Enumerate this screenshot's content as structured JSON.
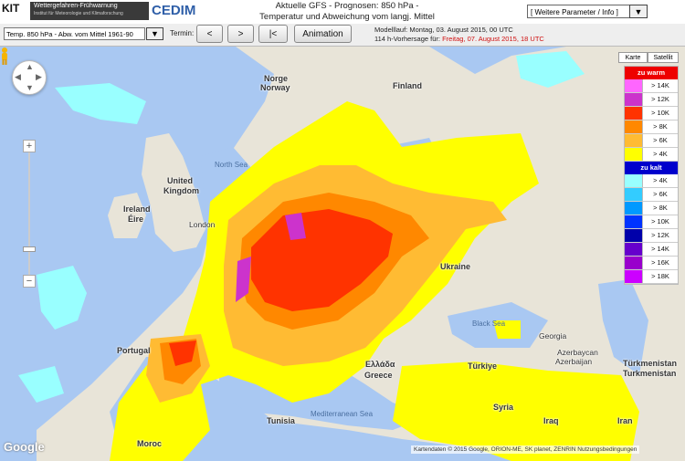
{
  "header": {
    "logo_kit": "KIT",
    "logo_wf_title": "Wettergefahren-Frühwarnung",
    "logo_wf_sub": "Institut für Meteorologie und Klimaforschung",
    "logo_cedim": "CEDIM",
    "title_line1": "Aktuelle GFS - Prognosen: 850 hPa -",
    "title_line2": "Temperatur und Abweichung vom langj. Mittel",
    "param_select": "[ Weitere Parameter / Info ]"
  },
  "toolbar": {
    "variable_select": "Temp. 850 hPa - Abw. vom Mittel 1961-90",
    "termin_label": "Termin:",
    "prev_label": "<",
    "next_label": ">",
    "first_label": "|<",
    "animation_label": "Animation",
    "modell_line": "Modelllauf: Montag, 03. August 2015, 00 UTC",
    "vorhersage_prefix": "114 h-Vorhersage für:",
    "vorhersage_value": "Freitag, 07. August 2015, 18 UTC"
  },
  "map": {
    "maptype_karte": "Karte",
    "maptype_satellit": "Satellit",
    "zoom_in": "+",
    "zoom_out": "−",
    "google": "Google",
    "footer": "Kartendaten © 2015 Google, ORION-ME, SK planet, ZENRIN   Nutzungsbedingungen",
    "labels": {
      "norway": "Norge",
      "norway2": "Norway",
      "finland": "Finland",
      "north_sea": "North Sea",
      "uk1": "United",
      "uk2": "Kingdom",
      "ireland1": "Ireland",
      "ireland2": "Éire",
      "london": "London",
      "portugal": "Portugal",
      "ukraine": "Ukraine",
      "black_sea": "Black Sea",
      "georgia": "Georgia",
      "azerbaijan": "Azerbaycan",
      "azerbaijan2": "Azerbaijan",
      "turkmen1": "Türkmenistan",
      "turkmen2": "Turkmenistan",
      "greece1": "Ελλάδα",
      "greece2": "Greece",
      "turkey": "Türkiye",
      "syria": "Syria",
      "iraq": "Iraq",
      "iran": "Iran",
      "tunisia": "Tunisia",
      "morocco": "Moroc",
      "med_sea": "Mediterranean Sea"
    }
  },
  "legend": {
    "warm_header": "zu warm",
    "cold_header": "zu kalt",
    "warm": [
      {
        "label": "> 14K",
        "color": "#ff66ff"
      },
      {
        "label": "> 12K",
        "color": "#cc33cc"
      },
      {
        "label": "> 10K",
        "color": "#ff3300"
      },
      {
        "label": "> 8K",
        "color": "#ff8800"
      },
      {
        "label": "> 6K",
        "color": "#ffbb33"
      },
      {
        "label": "> 4K",
        "color": "#ffff00"
      }
    ],
    "cold": [
      {
        "label": "> 4K",
        "color": "#99ffff"
      },
      {
        "label": "> 6K",
        "color": "#33ccff"
      },
      {
        "label": "> 8K",
        "color": "#0099ff"
      },
      {
        "label": "> 10K",
        "color": "#0033ff"
      },
      {
        "label": "> 12K",
        "color": "#0000aa"
      },
      {
        "label": "> 14K",
        "color": "#6600cc"
      },
      {
        "label": "> 16K",
        "color": "#9900cc"
      },
      {
        "label": "> 18K",
        "color": "#cc00ff"
      }
    ]
  }
}
